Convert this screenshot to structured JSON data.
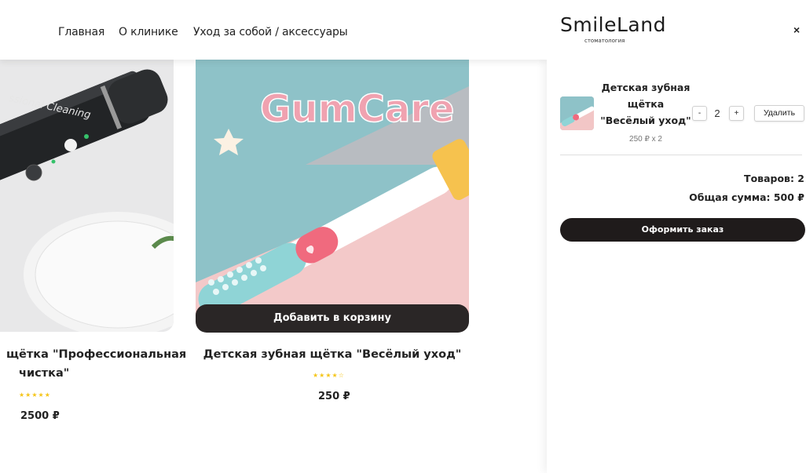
{
  "nav": {
    "home": "Главная",
    "clinic": "О клинике",
    "care": "Уход за собой / аксессуары"
  },
  "products": [
    {
      "title_line1": "щётка \"Профессиональная",
      "title_line2": "чистка\"",
      "rating": 5,
      "stars": "★★★★★",
      "price": "2500 ₽",
      "image_text": "ssional Cleaning"
    },
    {
      "title": "Детская зубная щётка \"Весёлый уход\"",
      "rating": 4,
      "stars": "★★★★☆",
      "price": "250 ₽",
      "image_text": "GumCare",
      "add_to_cart": "Добавить в корзину"
    }
  ],
  "cart": {
    "logo": "SmileLand",
    "logo_sub": "стоматология",
    "close": "×",
    "item": {
      "name": "Детская зубная щётка \"Весёлый уход\"",
      "price_line": "250 ₽ x 2",
      "qty": "2",
      "minus": "-",
      "plus": "+",
      "remove": "Удалить"
    },
    "count": "Товаров: 2",
    "sum": "Общая сумма: 500 ₽",
    "checkout": "Оформить заказ"
  },
  "colors": {
    "dark_button": "#2a2626",
    "star": "#f5c518",
    "img2_pink": "#f1c9c9",
    "img2_teal": "#8fc3c8"
  }
}
